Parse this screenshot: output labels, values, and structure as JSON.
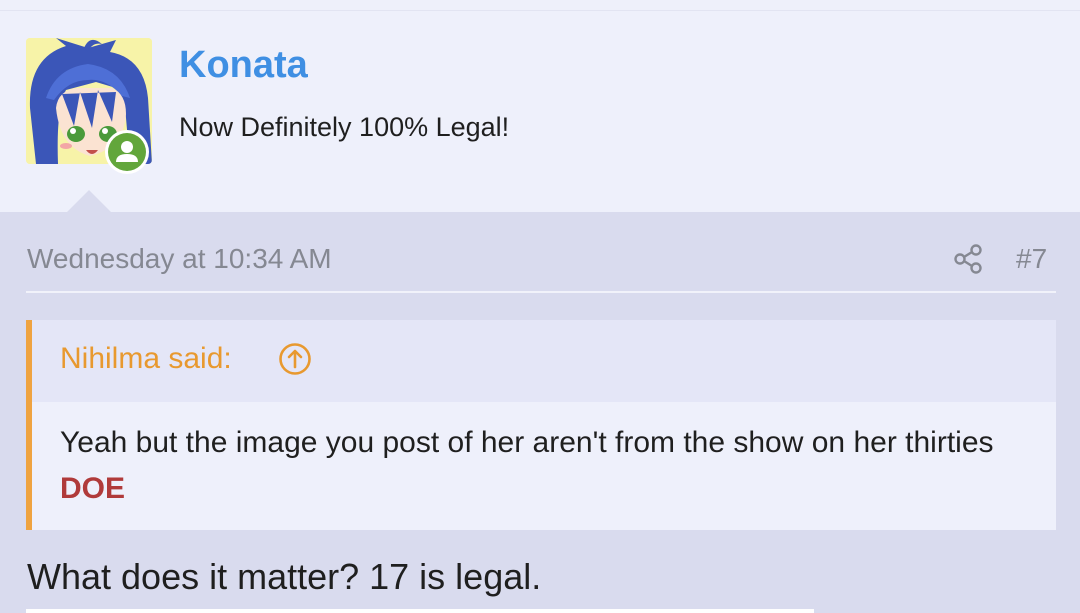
{
  "post": {
    "username": "Konata",
    "user_title": "Now Definitely 100% Legal!",
    "date": "Wednesday at 10:34 AM",
    "post_number": "#7",
    "quote": {
      "author_label": "Nihilma said:",
      "text": "Yeah but the image you post of her aren't from the show on her thirties",
      "emphasis": "DOE"
    },
    "reply": "What does it matter? 17 is legal."
  },
  "icons": {
    "share": "share-icon",
    "quote_jump": "arrow-up-circle-icon",
    "online": "user-online-icon"
  },
  "colors": {
    "username": "#3f8fe3",
    "quote_accent": "#efa340",
    "emphasis": "#b03a3a",
    "online_badge": "#62a63b"
  }
}
